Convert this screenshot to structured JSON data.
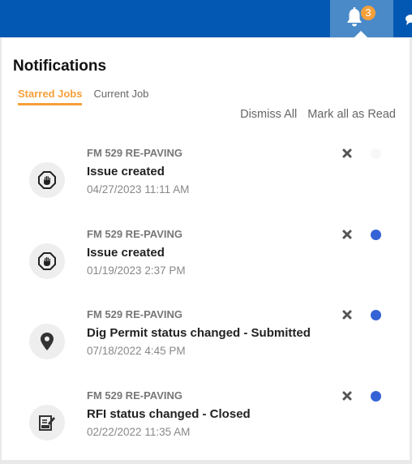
{
  "header": {
    "bell_badge_count": "3",
    "bell_icon": "bell-icon",
    "chat_icon": "chat-icon"
  },
  "panel": {
    "title": "Notifications",
    "tabs": [
      {
        "label": "Starred Jobs",
        "active": true
      },
      {
        "label": "Current Job",
        "active": false
      }
    ],
    "actions": {
      "dismiss_all": "Dismiss All",
      "mark_all_read": "Mark all as Read"
    },
    "notifications": [
      {
        "icon": "stop-hand-icon",
        "job": "FM 529 RE-PAVING",
        "message": "Issue created",
        "timestamp": "04/27/2023 11:11 AM",
        "unread": false
      },
      {
        "icon": "stop-hand-icon",
        "job": "FM 529 RE-PAVING",
        "message": "Issue created",
        "timestamp": "01/19/2023 2:37 PM",
        "unread": true
      },
      {
        "icon": "map-pin-icon",
        "job": "FM 529 RE-PAVING",
        "message": "Dig Permit status changed - Submitted",
        "timestamp": "07/18/2022 4:45 PM",
        "unread": true
      },
      {
        "icon": "edit-document-icon",
        "job": "FM 529 RE-PAVING",
        "message": "RFI status changed - Closed",
        "timestamp": "02/22/2022 11:35 AM",
        "unread": true
      }
    ]
  },
  "colors": {
    "topbar": "#0358b4",
    "bell_active_bg": "#4a8ac8",
    "accent_orange": "#f5a03a",
    "unread_dot": "#3563d6"
  }
}
